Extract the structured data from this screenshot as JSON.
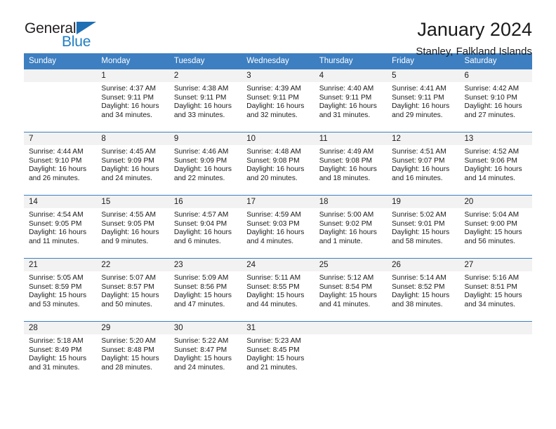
{
  "brand": {
    "name_part1": "General",
    "name_part2": "Blue",
    "triangle_color": "#1f6fb4",
    "blue_color": "#1f7fc4"
  },
  "header": {
    "title": "January 2024",
    "subtitle": "Stanley, Falkland Islands"
  },
  "theme": {
    "header_row_bg": "#3d7fc1",
    "daynum_bg": "#f2f2f2",
    "cell_bg": "#ffffff",
    "text_color": "#1a1a1a"
  },
  "weekdays": [
    "Sunday",
    "Monday",
    "Tuesday",
    "Wednesday",
    "Thursday",
    "Friday",
    "Saturday"
  ],
  "weeks": [
    [
      {
        "day": "",
        "blank": true,
        "sunrise": "",
        "sunset": "",
        "daylight": ""
      },
      {
        "day": "1",
        "sunrise": "Sunrise: 4:37 AM",
        "sunset": "Sunset: 9:11 PM",
        "daylight": "Daylight: 16 hours and 34 minutes."
      },
      {
        "day": "2",
        "sunrise": "Sunrise: 4:38 AM",
        "sunset": "Sunset: 9:11 PM",
        "daylight": "Daylight: 16 hours and 33 minutes."
      },
      {
        "day": "3",
        "sunrise": "Sunrise: 4:39 AM",
        "sunset": "Sunset: 9:11 PM",
        "daylight": "Daylight: 16 hours and 32 minutes."
      },
      {
        "day": "4",
        "sunrise": "Sunrise: 4:40 AM",
        "sunset": "Sunset: 9:11 PM",
        "daylight": "Daylight: 16 hours and 31 minutes."
      },
      {
        "day": "5",
        "sunrise": "Sunrise: 4:41 AM",
        "sunset": "Sunset: 9:11 PM",
        "daylight": "Daylight: 16 hours and 29 minutes."
      },
      {
        "day": "6",
        "sunrise": "Sunrise: 4:42 AM",
        "sunset": "Sunset: 9:10 PM",
        "daylight": "Daylight: 16 hours and 27 minutes."
      }
    ],
    [
      {
        "day": "7",
        "sunrise": "Sunrise: 4:44 AM",
        "sunset": "Sunset: 9:10 PM",
        "daylight": "Daylight: 16 hours and 26 minutes."
      },
      {
        "day": "8",
        "sunrise": "Sunrise: 4:45 AM",
        "sunset": "Sunset: 9:09 PM",
        "daylight": "Daylight: 16 hours and 24 minutes."
      },
      {
        "day": "9",
        "sunrise": "Sunrise: 4:46 AM",
        "sunset": "Sunset: 9:09 PM",
        "daylight": "Daylight: 16 hours and 22 minutes."
      },
      {
        "day": "10",
        "sunrise": "Sunrise: 4:48 AM",
        "sunset": "Sunset: 9:08 PM",
        "daylight": "Daylight: 16 hours and 20 minutes."
      },
      {
        "day": "11",
        "sunrise": "Sunrise: 4:49 AM",
        "sunset": "Sunset: 9:08 PM",
        "daylight": "Daylight: 16 hours and 18 minutes."
      },
      {
        "day": "12",
        "sunrise": "Sunrise: 4:51 AM",
        "sunset": "Sunset: 9:07 PM",
        "daylight": "Daylight: 16 hours and 16 minutes."
      },
      {
        "day": "13",
        "sunrise": "Sunrise: 4:52 AM",
        "sunset": "Sunset: 9:06 PM",
        "daylight": "Daylight: 16 hours and 14 minutes."
      }
    ],
    [
      {
        "day": "14",
        "sunrise": "Sunrise: 4:54 AM",
        "sunset": "Sunset: 9:05 PM",
        "daylight": "Daylight: 16 hours and 11 minutes."
      },
      {
        "day": "15",
        "sunrise": "Sunrise: 4:55 AM",
        "sunset": "Sunset: 9:05 PM",
        "daylight": "Daylight: 16 hours and 9 minutes."
      },
      {
        "day": "16",
        "sunrise": "Sunrise: 4:57 AM",
        "sunset": "Sunset: 9:04 PM",
        "daylight": "Daylight: 16 hours and 6 minutes."
      },
      {
        "day": "17",
        "sunrise": "Sunrise: 4:59 AM",
        "sunset": "Sunset: 9:03 PM",
        "daylight": "Daylight: 16 hours and 4 minutes."
      },
      {
        "day": "18",
        "sunrise": "Sunrise: 5:00 AM",
        "sunset": "Sunset: 9:02 PM",
        "daylight": "Daylight: 16 hours and 1 minute."
      },
      {
        "day": "19",
        "sunrise": "Sunrise: 5:02 AM",
        "sunset": "Sunset: 9:01 PM",
        "daylight": "Daylight: 15 hours and 58 minutes."
      },
      {
        "day": "20",
        "sunrise": "Sunrise: 5:04 AM",
        "sunset": "Sunset: 9:00 PM",
        "daylight": "Daylight: 15 hours and 56 minutes."
      }
    ],
    [
      {
        "day": "21",
        "sunrise": "Sunrise: 5:05 AM",
        "sunset": "Sunset: 8:59 PM",
        "daylight": "Daylight: 15 hours and 53 minutes."
      },
      {
        "day": "22",
        "sunrise": "Sunrise: 5:07 AM",
        "sunset": "Sunset: 8:57 PM",
        "daylight": "Daylight: 15 hours and 50 minutes."
      },
      {
        "day": "23",
        "sunrise": "Sunrise: 5:09 AM",
        "sunset": "Sunset: 8:56 PM",
        "daylight": "Daylight: 15 hours and 47 minutes."
      },
      {
        "day": "24",
        "sunrise": "Sunrise: 5:11 AM",
        "sunset": "Sunset: 8:55 PM",
        "daylight": "Daylight: 15 hours and 44 minutes."
      },
      {
        "day": "25",
        "sunrise": "Sunrise: 5:12 AM",
        "sunset": "Sunset: 8:54 PM",
        "daylight": "Daylight: 15 hours and 41 minutes."
      },
      {
        "day": "26",
        "sunrise": "Sunrise: 5:14 AM",
        "sunset": "Sunset: 8:52 PM",
        "daylight": "Daylight: 15 hours and 38 minutes."
      },
      {
        "day": "27",
        "sunrise": "Sunrise: 5:16 AM",
        "sunset": "Sunset: 8:51 PM",
        "daylight": "Daylight: 15 hours and 34 minutes."
      }
    ],
    [
      {
        "day": "28",
        "sunrise": "Sunrise: 5:18 AM",
        "sunset": "Sunset: 8:49 PM",
        "daylight": "Daylight: 15 hours and 31 minutes."
      },
      {
        "day": "29",
        "sunrise": "Sunrise: 5:20 AM",
        "sunset": "Sunset: 8:48 PM",
        "daylight": "Daylight: 15 hours and 28 minutes."
      },
      {
        "day": "30",
        "sunrise": "Sunrise: 5:22 AM",
        "sunset": "Sunset: 8:47 PM",
        "daylight": "Daylight: 15 hours and 24 minutes."
      },
      {
        "day": "31",
        "sunrise": "Sunrise: 5:23 AM",
        "sunset": "Sunset: 8:45 PM",
        "daylight": "Daylight: 15 hours and 21 minutes."
      },
      {
        "day": "",
        "blank": true,
        "sunrise": "",
        "sunset": "",
        "daylight": ""
      },
      {
        "day": "",
        "blank": true,
        "sunrise": "",
        "sunset": "",
        "daylight": ""
      },
      {
        "day": "",
        "blank": true,
        "sunrise": "",
        "sunset": "",
        "daylight": ""
      }
    ]
  ]
}
